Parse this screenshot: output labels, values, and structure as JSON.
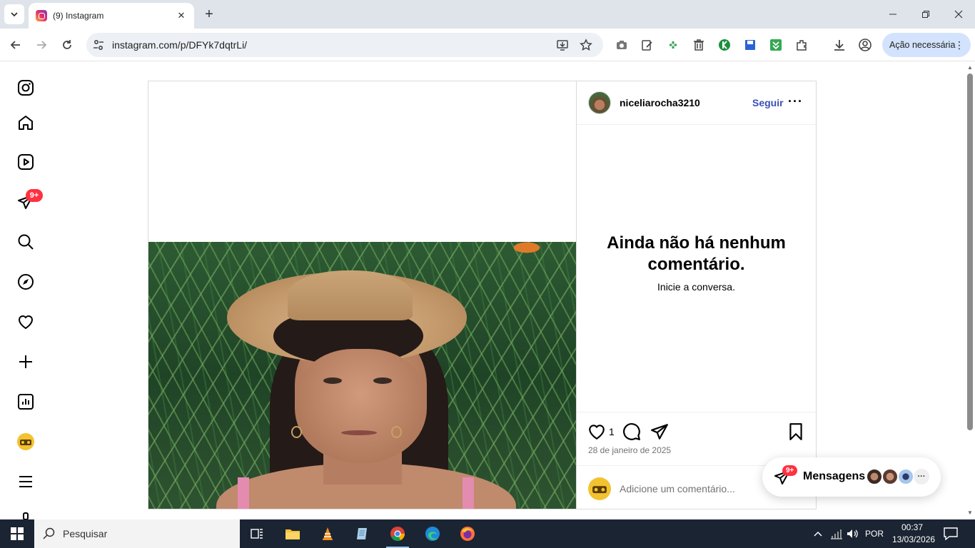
{
  "browser": {
    "tab_title": "(9) Instagram",
    "url": "instagram.com/p/DFYk7dqtrLi/",
    "action_chip": "Ação necessária"
  },
  "sidebar": {
    "notifications_badge": "9+"
  },
  "post": {
    "username": "niceliarocha3210",
    "follow_label": "Seguir",
    "empty_title": "Ainda não há nenhum comentário.",
    "empty_subtitle": "Inicie a conversa.",
    "like_count": "1",
    "date": "28 de janeiro de 2025",
    "comment_placeholder": "Adicione um comentário..."
  },
  "messages": {
    "label": "Mensagens",
    "badge": "9+"
  },
  "taskbar": {
    "search_placeholder": "Pesquisar",
    "language": "POR",
    "time": "00:37",
    "date": "13/03/2026"
  },
  "colors": {
    "accent_blue": "#3b4fb5",
    "badge_red": "#ff3040",
    "chip_blue": "#d3e3fd"
  }
}
